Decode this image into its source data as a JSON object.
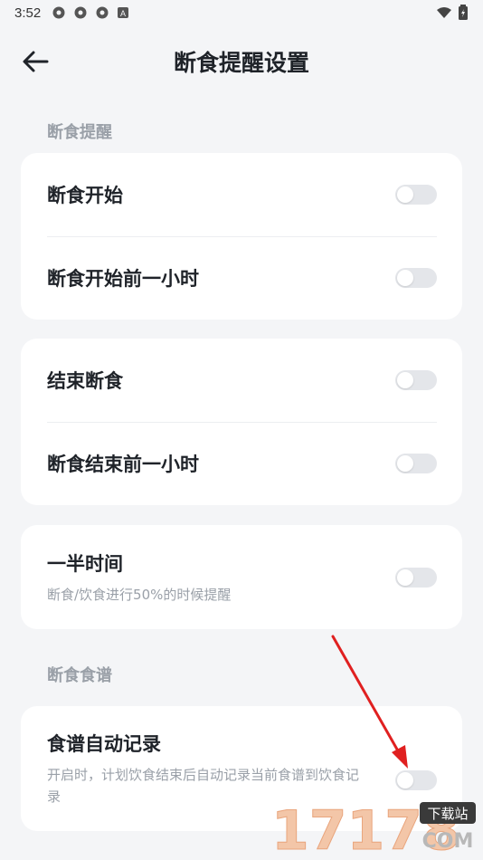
{
  "status_bar": {
    "time": "3:52",
    "app_icons": [
      "settings-icon",
      "settings-icon",
      "settings-icon",
      "a-icon"
    ],
    "right_icons": [
      "wifi-icon",
      "battery-icon"
    ]
  },
  "header": {
    "title": "断食提醒设置",
    "back_icon": "back-arrow-icon"
  },
  "sections": {
    "reminder_label": "断食提醒",
    "recipe_label": "断食食谱"
  },
  "cards": {
    "fast_start": {
      "title": "断食开始",
      "enabled": false
    },
    "fast_start_hour_before": {
      "title": "断食开始前一小时",
      "enabled": false
    },
    "end_fast": {
      "title": "结束断食",
      "enabled": false
    },
    "fast_end_hour_before": {
      "title": "断食结束前一小时",
      "enabled": false
    },
    "halfway": {
      "title": "一半时间",
      "desc": "断食/饮食进行50%的时候提醒",
      "enabled": false
    },
    "recipe_auto_record": {
      "title": "食谱自动记录",
      "desc": "开启时，计划饮食结束后自动记录当前食谱到饮食记录",
      "enabled": false
    }
  },
  "annotation": {
    "arrow_color": "#e02020"
  },
  "watermark": {
    "number": "17178",
    "label": "下载站",
    "domain": "COM"
  },
  "colors": {
    "background": "#f4f5f7",
    "card": "#ffffff",
    "title": "#1f2329",
    "muted": "#9aa0a8",
    "toggle_off": "#e4e6ea"
  }
}
